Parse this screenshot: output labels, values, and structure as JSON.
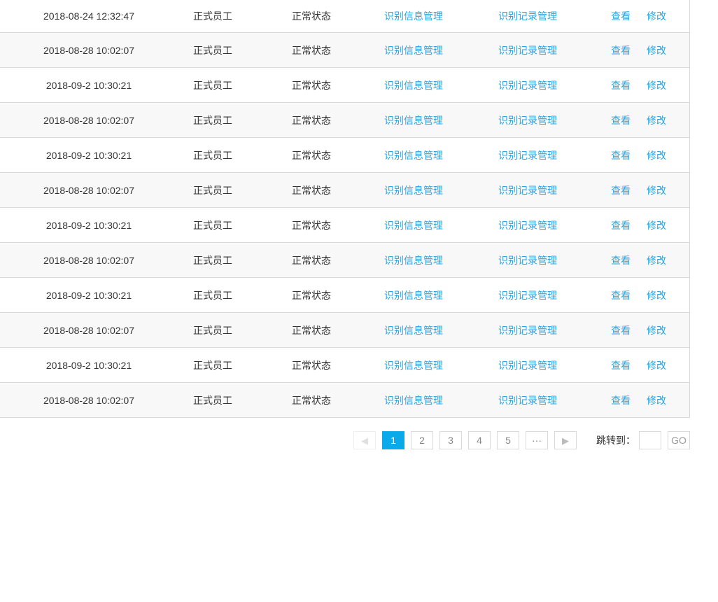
{
  "table": {
    "rows": [
      {
        "time": "2018-08-24  12:32:47",
        "type": "正式员工",
        "status": "正常状态",
        "info_link": "识别信息管理",
        "record_link": "识别记录管理",
        "view": "查看",
        "edit": "修改"
      },
      {
        "time": "2018-08-28  10:02:07",
        "type": "正式员工",
        "status": "正常状态",
        "info_link": "识别信息管理",
        "record_link": "识别记录管理",
        "view": "查看",
        "edit": "修改"
      },
      {
        "time": "2018-09-2  10:30:21",
        "type": "正式员工",
        "status": "正常状态",
        "info_link": "识别信息管理",
        "record_link": "识别记录管理",
        "view": "查看",
        "edit": "修改"
      },
      {
        "time": "2018-08-28  10:02:07",
        "type": "正式员工",
        "status": "正常状态",
        "info_link": "识别信息管理",
        "record_link": "识别记录管理",
        "view": "查看",
        "edit": "修改"
      },
      {
        "time": "2018-09-2  10:30:21",
        "type": "正式员工",
        "status": "正常状态",
        "info_link": "识别信息管理",
        "record_link": "识别记录管理",
        "view": "查看",
        "edit": "修改"
      },
      {
        "time": "2018-08-28  10:02:07",
        "type": "正式员工",
        "status": "正常状态",
        "info_link": "识别信息管理",
        "record_link": "识别记录管理",
        "view": "查看",
        "edit": "修改"
      },
      {
        "time": "2018-09-2  10:30:21",
        "type": "正式员工",
        "status": "正常状态",
        "info_link": "识别信息管理",
        "record_link": "识别记录管理",
        "view": "查看",
        "edit": "修改"
      },
      {
        "time": "2018-08-28  10:02:07",
        "type": "正式员工",
        "status": "正常状态",
        "info_link": "识别信息管理",
        "record_link": "识别记录管理",
        "view": "查看",
        "edit": "修改"
      },
      {
        "time": "2018-09-2  10:30:21",
        "type": "正式员工",
        "status": "正常状态",
        "info_link": "识别信息管理",
        "record_link": "识别记录管理",
        "view": "查看",
        "edit": "修改"
      },
      {
        "time": "2018-08-28  10:02:07",
        "type": "正式员工",
        "status": "正常状态",
        "info_link": "识别信息管理",
        "record_link": "识别记录管理",
        "view": "查看",
        "edit": "修改"
      },
      {
        "time": "2018-09-2  10:30:21",
        "type": "正式员工",
        "status": "正常状态",
        "info_link": "识别信息管理",
        "record_link": "识别记录管理",
        "view": "查看",
        "edit": "修改"
      },
      {
        "time": "2018-08-28  10:02:07",
        "type": "正式员工",
        "status": "正常状态",
        "info_link": "识别信息管理",
        "record_link": "识别记录管理",
        "view": "查看",
        "edit": "修改"
      }
    ]
  },
  "pagination": {
    "prev_icon": "triangle-left-icon",
    "next_icon": "triangle-right-icon",
    "pages": [
      "1",
      "2",
      "3",
      "4",
      "5"
    ],
    "ellipsis": "···",
    "current_page": "1",
    "jump_label": "跳转到：",
    "jump_value": "",
    "go_label": "GO"
  },
  "colors": {
    "link": "#29a5df",
    "active_page": "#0aa9ea",
    "alt_row": "#f8f8f8",
    "border": "#d9d9d9"
  }
}
